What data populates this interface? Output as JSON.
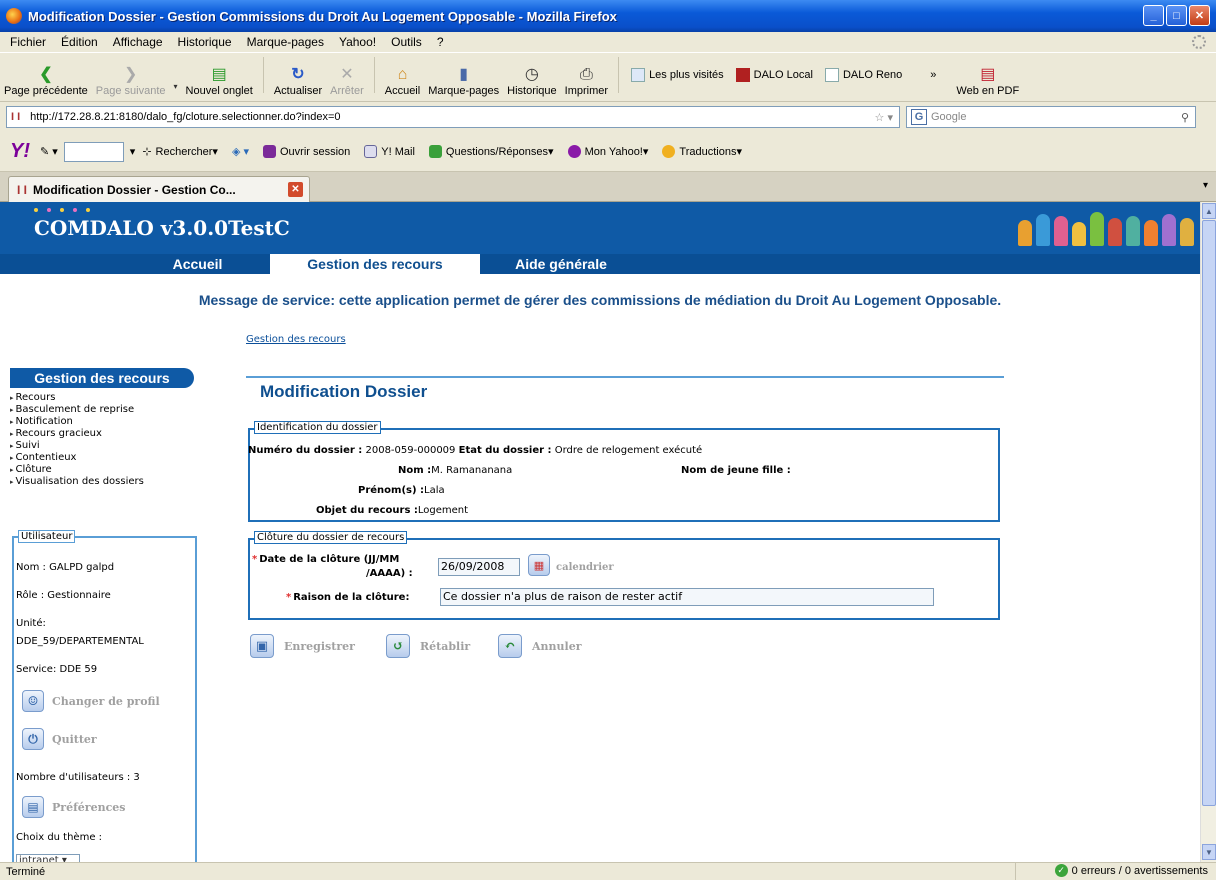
{
  "window": {
    "title": "Modification Dossier - Gestion Commissions du Droit Au Logement Opposable - Mozilla Firefox"
  },
  "menubar": [
    "Fichier",
    "Édition",
    "Affichage",
    "Historique",
    "Marque-pages",
    "Yahoo!",
    "Outils",
    "?"
  ],
  "toolbar": {
    "back": "Page précédente",
    "forward": "Page suivante",
    "new_tab": "Nouvel onglet",
    "reload": "Actualiser",
    "stop": "Arrêter",
    "home": "Accueil",
    "bookmarks": "Marque-pages",
    "history": "Historique",
    "print": "Imprimer",
    "most_visited": "Les plus visités",
    "dalo_local": "DALO Local",
    "dalo_reno": "DALO Reno",
    "more": "»",
    "web_pdf": "Web en PDF"
  },
  "urlbar": {
    "url": "http://172.28.8.21:8180/dalo_fg/cloture.selectionner.do?index=0",
    "search_placeholder": "Google"
  },
  "yahoobar": {
    "logo": "Y!",
    "search": "Rechercher",
    "login": "Ouvrir session",
    "mail": "Y! Mail",
    "answers": "Questions/Réponses",
    "my_yahoo": "Mon Yahoo!",
    "translations": "Traductions"
  },
  "tab": {
    "label": "Modification Dossier - Gestion Co..."
  },
  "app": {
    "title": "COMDALO v3.0.0TestC",
    "nav": [
      "Accueil",
      "Gestion des recours",
      "Aide générale"
    ],
    "service_message": "Message de service: cette application permet de gérer des commissions de médiation du Droit Au Logement Opposable.",
    "breadcrumb": "Gestion des recours"
  },
  "left_menu": {
    "title": "Gestion des recours",
    "items": [
      "Recours",
      "Basculement de reprise",
      "Notification",
      "Recours gracieux",
      "Suivi",
      "Contentieux",
      "Clôture",
      "Visualisation des dossiers"
    ]
  },
  "user": {
    "legend": "Utilisateur",
    "nom": "Nom : GALPD galpd",
    "role": "Rôle : Gestionnaire",
    "unite_label": "Unité:",
    "unite_value": "DDE_59/DEPARTEMENTAL",
    "service": "Service: DDE 59",
    "change_profile": "Changer de profil",
    "quit": "Quitter",
    "user_count": "Nombre d'utilisateurs : 3",
    "preferences": "Préférences",
    "theme_label": "Choix du thème :",
    "theme_value": "intranet"
  },
  "form": {
    "title": "Modification Dossier",
    "ident": {
      "legend": "Identification du dossier",
      "numero_label": "Numéro du dossier :",
      "numero_value": "2008-059-000009",
      "etat_label": "Etat du dossier :",
      "etat_value": "Ordre de relogement exécuté",
      "nom_label": "Nom :",
      "nom_value": "M.  Ramananana",
      "jeune_fille_label": "Nom de jeune fille :",
      "prenom_label": "Prénom(s) :",
      "prenom_value": "Lala",
      "objet_label": "Objet du recours :",
      "objet_value": "Logement"
    },
    "cloture": {
      "legend": "Clôture du dossier de recours",
      "date_label_1": "Date de la clôture (JJ/MM",
      "date_label_2": "/AAAA) :",
      "date_value": "26/09/2008",
      "calendar": "calendrier",
      "raison_label": "Raison de la clôture:",
      "raison_value": "Ce dossier n'a plus de raison de rester actif"
    },
    "actions": {
      "save": "Enregistrer",
      "reset": "Rétablir",
      "cancel": "Annuler"
    }
  },
  "status": {
    "left": "Terminé",
    "right": "0 erreurs / 0 avertissements"
  },
  "colors": {
    "app_header": "#0f5aa6",
    "accent_blue": "#1f6fb8",
    "required_star": "#e03030"
  }
}
